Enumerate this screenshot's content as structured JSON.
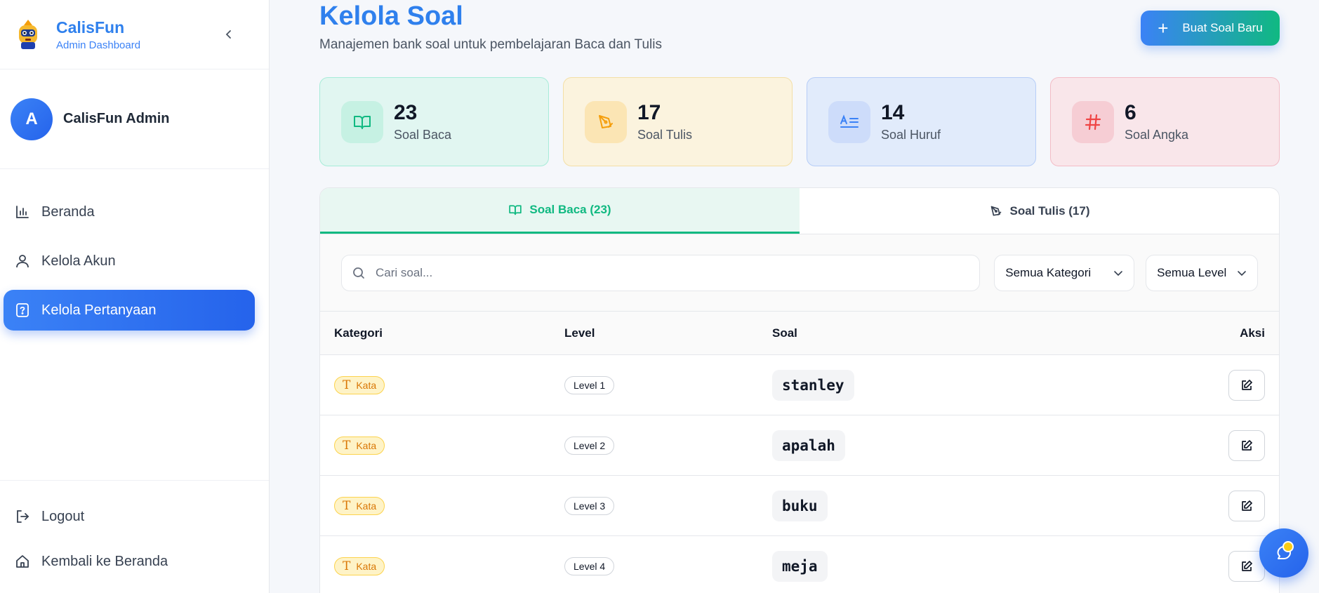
{
  "brand": {
    "name": "CalisFun",
    "subtitle": "Admin Dashboard"
  },
  "user": {
    "initial": "A",
    "name": "CalisFun Admin"
  },
  "nav": [
    {
      "label": "Beranda",
      "icon": "bar-chart-icon"
    },
    {
      "label": "Kelola Akun",
      "icon": "user-icon"
    },
    {
      "label": "Kelola Pertanyaan",
      "icon": "question-file-icon",
      "active": true
    }
  ],
  "nav_bottom": [
    {
      "label": "Logout",
      "icon": "logout-icon"
    },
    {
      "label": "Kembali ke Beranda",
      "icon": "home-icon"
    }
  ],
  "page": {
    "title": "Kelola Soal",
    "subtitle": "Manajemen bank soal untuk pembelajaran Baca dan Tulis",
    "new_button": "Buat Soal Baru"
  },
  "stats": [
    {
      "value": "23",
      "label": "Soal Baca",
      "icon": "book-icon",
      "color": "#10b981"
    },
    {
      "value": "17",
      "label": "Soal Tulis",
      "icon": "pen-icon",
      "color": "#f59e0b"
    },
    {
      "value": "14",
      "label": "Soal Huruf",
      "icon": "letters-icon",
      "color": "#3b82f6"
    },
    {
      "value": "6",
      "label": "Soal Angka",
      "icon": "hash-icon",
      "color": "#ef4444"
    }
  ],
  "tabs": [
    {
      "label": "Soal Baca (23)",
      "active": true
    },
    {
      "label": "Soal Tulis (17)",
      "active": false
    }
  ],
  "search": {
    "placeholder": "Cari soal..."
  },
  "filters": {
    "category": "Semua Kategori",
    "level": "Semua Level"
  },
  "table": {
    "headers": [
      "Kategori",
      "Level",
      "Soal",
      "Aksi"
    ],
    "rows": [
      {
        "category": "Kata",
        "level": "Level 1",
        "question": "stanley"
      },
      {
        "category": "Kata",
        "level": "Level 2",
        "question": "apalah"
      },
      {
        "category": "Kata",
        "level": "Level 3",
        "question": "buku"
      },
      {
        "category": "Kata",
        "level": "Level 4",
        "question": "meja"
      }
    ]
  },
  "colors": {
    "primary": "#3b82f6",
    "accent": "#10b981",
    "kata_badge": "#d97706"
  }
}
